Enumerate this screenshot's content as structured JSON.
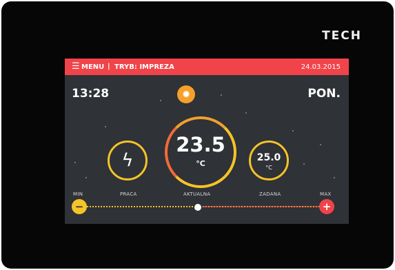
{
  "device": {
    "brand": "TECH"
  },
  "topbar": {
    "menu_icon": "menu-icon",
    "menu_label": "MENU",
    "separator": "|",
    "mode_label": "TRYB: IMPREZA",
    "date": "24.03.2015"
  },
  "status": {
    "time": "13:28",
    "day": "PON."
  },
  "weather": {
    "icon": "sun-icon"
  },
  "work": {
    "icon": "lightning-icon",
    "label": "PRACA"
  },
  "current": {
    "value": "23.5",
    "unit": "°C",
    "label": "AKTUALNA"
  },
  "setpoint": {
    "value": "25.0",
    "unit": "°C",
    "label": "ZADANA"
  },
  "slider": {
    "min_label": "MIN",
    "max_label": "MAX",
    "minus_label": "−",
    "plus_label": "+"
  },
  "colors": {
    "accent_red": "#f0444a",
    "accent_yellow": "#f6c328",
    "accent_orange": "#f6a02a",
    "screen_bg": "#2f3236"
  }
}
